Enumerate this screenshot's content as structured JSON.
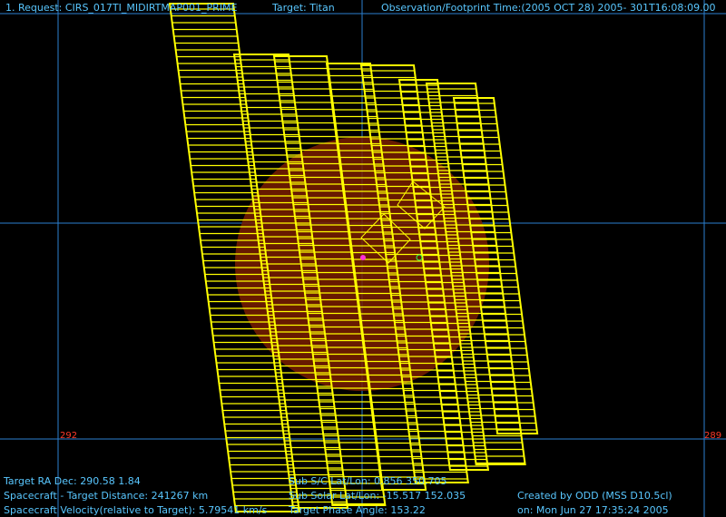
{
  "header": {
    "request": "1. Request: CIRS_017TI_MIDIRTMAP001_PRIME",
    "target": "Target: Titan",
    "observation": "Observation/Footprint Time:(2005 OCT 28) 2005- 301T16:08:09.00"
  },
  "axis_labels": {
    "left": "292",
    "right": "289"
  },
  "footer": {
    "ra_dec": "Target RA  Dec: 290.58    1.84",
    "distance": "Spacecraft - Target Distance:  241267 km",
    "velocity": "Spacecraft Velocity(relative to Target): 5.79541 km/s",
    "subpoint1": "Sub S/C Lat/Lon: 0.856   350.705",
    "subpoint2": "Sub Solar Lat/Lon: -15.517   152.035",
    "phase": "Target Phase Angle: 153.22",
    "created_by": "Created by ODD (MSS D10.5cl)",
    "created_on": "on: Mon Jun 27 17:35:24 2005"
  },
  "colors": {
    "background": "#000000",
    "grid": "#2b7fd0",
    "text": "#59c7ff",
    "footprint": "#ffff00",
    "target_disk": "#7a1f00",
    "axis_number": "#ff3a2a"
  }
}
